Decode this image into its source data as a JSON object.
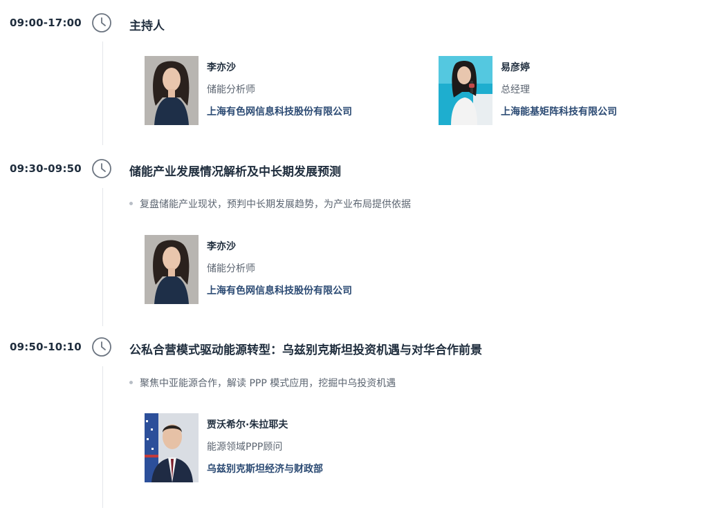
{
  "sessions": [
    {
      "time": "09:00-17:00",
      "title": "主持人",
      "speakers": [
        {
          "name": "李亦沙",
          "role": "储能分析师",
          "org": "上海有色网信息科技股份有限公司"
        },
        {
          "name": "易彦婷",
          "role": "总经理",
          "org": "上海能基矩阵科技有限公司"
        }
      ]
    },
    {
      "time": "09:30-09:50",
      "title": "储能产业发展情况解析及中长期发展预测",
      "description": "复盘储能产业现状，预判中长期发展趋势，为产业布局提供依据",
      "speakers": [
        {
          "name": "李亦沙",
          "role": "储能分析师",
          "org": "上海有色网信息科技股份有限公司"
        }
      ]
    },
    {
      "time": "09:50-10:10",
      "title": "公私合营模式驱动能源转型：乌兹别克斯坦投资机遇与对华合作前景",
      "description": "聚焦中亚能源合作，解读 PPP 模式应用，挖掘中乌投资机遇",
      "speakers": [
        {
          "name": "贾沃希尔·朱拉耶夫",
          "role": "能源领域PPP顾问",
          "org": "乌兹别克斯坦经济与财政部"
        }
      ]
    }
  ],
  "icons": {
    "clock": "clock-icon",
    "bullet": "bullet-dot-icon"
  },
  "colors": {
    "text": "#1f2d3d",
    "org": "#2b4a73",
    "muted": "#5b6470",
    "line": "#e3e6ea"
  }
}
